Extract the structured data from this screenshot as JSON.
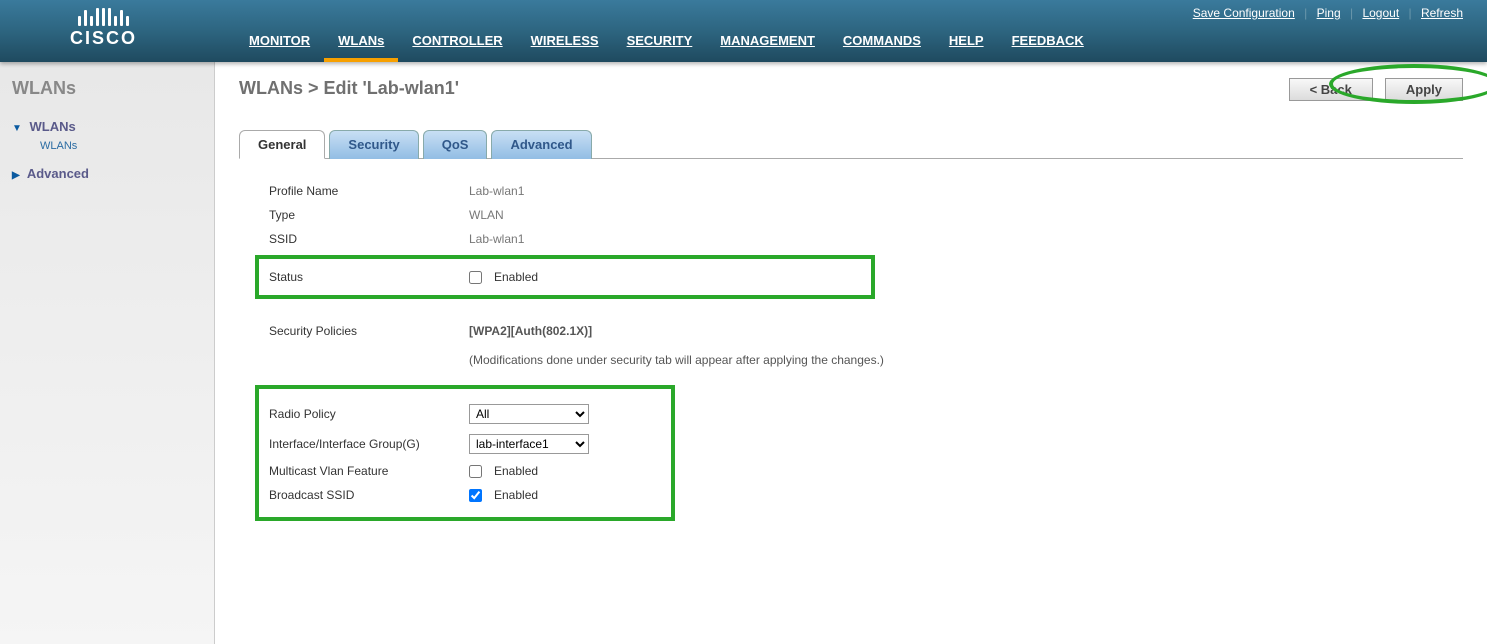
{
  "brand": "CISCO",
  "topLinks": {
    "save": "Save Configuration",
    "ping": "Ping",
    "logout": "Logout",
    "refresh": "Refresh"
  },
  "mainNav": {
    "monitor": "MONITOR",
    "wlans": "WLANs",
    "controller": "CONTROLLER",
    "wireless": "WIRELESS",
    "security": "SECURITY",
    "management": "MANAGEMENT",
    "commands": "COMMANDS",
    "help": "HELP",
    "feedback": "FEEDBACK"
  },
  "sidebar": {
    "title": "WLANs",
    "section1": "WLANs",
    "sub1": "WLANs",
    "section2": "Advanced"
  },
  "page": {
    "breadcrumb": "WLANs > Edit   'Lab-wlan1'",
    "backBtn": "< Back",
    "applyBtn": "Apply"
  },
  "tabs": {
    "general": "General",
    "security": "Security",
    "qos": "QoS",
    "advanced": "Advanced"
  },
  "form": {
    "profileNameLabel": "Profile Name",
    "profileNameValue": "Lab-wlan1",
    "typeLabel": "Type",
    "typeValue": "WLAN",
    "ssidLabel": "SSID",
    "ssidValue": "Lab-wlan1",
    "statusLabel": "Status",
    "statusEnabled": "Enabled",
    "secPolLabel": "Security Policies",
    "secPolValue": "[WPA2][Auth(802.1X)]",
    "secNote": "(Modifications done under security tab will appear after applying the changes.)",
    "radioLabel": "Radio Policy",
    "radioValue": "All",
    "ifaceLabel": "Interface/Interface Group(G)",
    "ifaceValue": "lab-interface1",
    "mcastLabel": "Multicast Vlan Feature",
    "mcastEnabled": "Enabled",
    "bcastLabel": "Broadcast SSID",
    "bcastEnabled": "Enabled"
  }
}
